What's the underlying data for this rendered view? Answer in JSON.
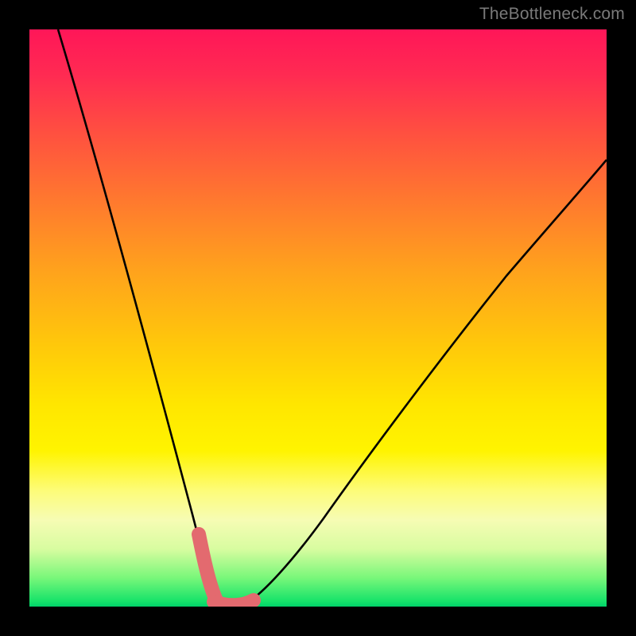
{
  "watermark": "TheBottleneck.com",
  "chart_data": {
    "type": "line",
    "title": "",
    "xlabel": "",
    "ylabel": "",
    "xlim": [
      0,
      100
    ],
    "ylim": [
      0,
      100
    ],
    "background_gradient": {
      "top_color": "#ff1658",
      "mid_color": "#ffe600",
      "bottom_color": "#00d36a"
    },
    "series": [
      {
        "name": "bottleneck-curve",
        "color": "#000000",
        "x": [
          5,
          10,
          15,
          20,
          25,
          27,
          29,
          30,
          31,
          32,
          33,
          35,
          40,
          45,
          50,
          55,
          60,
          65,
          70,
          75,
          80,
          85,
          90,
          95,
          100
        ],
        "y": [
          100,
          82,
          64,
          46,
          28,
          18,
          8,
          4,
          1,
          0,
          0,
          0,
          4,
          11,
          19,
          27,
          35,
          43,
          51,
          58,
          64,
          70,
          75,
          79,
          83
        ]
      },
      {
        "name": "highlight-segment",
        "color": "#e36a6f",
        "x": [
          28,
          29,
          30,
          31,
          32,
          33,
          34,
          35,
          36,
          37
        ],
        "y": [
          12,
          8,
          4,
          1,
          0,
          0,
          0,
          0,
          1,
          3
        ]
      }
    ],
    "highlight": {
      "color": "#e36a6f",
      "stroke_width_px": 18,
      "note": "Thick pink overlay near curve minimum"
    }
  }
}
